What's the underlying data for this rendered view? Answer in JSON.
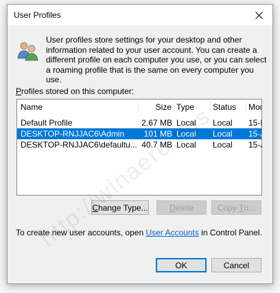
{
  "window": {
    "title": "User Profiles",
    "close_glyph": "✕"
  },
  "description": {
    "text": "User profiles store settings for your desktop and other information related to your user account. You can create a different profile on each computer you use, or you can select a roaming profile that is the same on every computer you use.",
    "icon": "users-icon"
  },
  "profiles_label": {
    "accel": "P",
    "rest": "rofiles stored on this computer:"
  },
  "table": {
    "columns": [
      "Name",
      "Size",
      "Type",
      "Status",
      "Mod..."
    ],
    "rows": [
      {
        "name": "Default Profile",
        "size": "2.67 MB",
        "type": "Local",
        "status": "Local",
        "modified": "15-F..."
      },
      {
        "name": "DESKTOP-RNJJAC6\\Admin",
        "size": "101 MB",
        "type": "Local",
        "status": "Local",
        "modified": "15-A..."
      },
      {
        "name": "DESKTOP-RNJJAC6\\defaultu...",
        "size": "40.7 MB",
        "type": "Local",
        "status": "Local",
        "modified": "15-A..."
      }
    ],
    "selected_index": 1
  },
  "buttons": {
    "change_type": {
      "accel": "C",
      "rest": "hange Type..."
    },
    "delete": {
      "accel": "D",
      "rest": "elete"
    },
    "copy_to": {
      "pre": "Copy ",
      "accel": "T",
      "rest": "o..."
    },
    "ok": "OK",
    "cancel": "Cancel"
  },
  "create_accounts": {
    "prefix": "To create new user accounts, open ",
    "link": "User Accounts",
    "suffix": " in Control Panel."
  },
  "watermark": "http://winaero.tips",
  "colors": {
    "selection": "#0078d7",
    "link": "#0066cc",
    "default_button_border": "#0078d7"
  }
}
